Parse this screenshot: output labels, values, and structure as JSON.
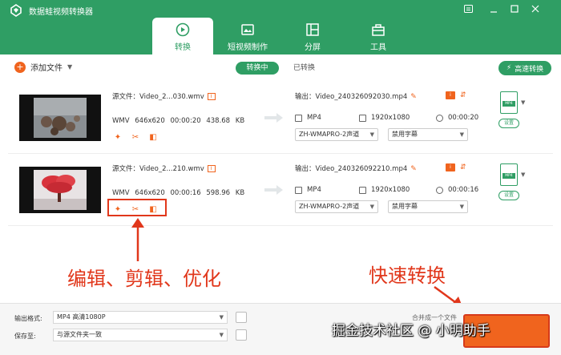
{
  "app": {
    "title": "数据蛙视频转换器",
    "brand_color": "#2f9e64",
    "accent_color": "#f0641e",
    "annotation_color": "#e1371b"
  },
  "window_controls": [
    "menu-icon",
    "minimize-icon",
    "restore-icon",
    "close-icon"
  ],
  "nav": {
    "tabs": [
      {
        "label": "转换",
        "icon": "convert-icon",
        "active": true
      },
      {
        "label": "短视频制作",
        "icon": "clip-icon",
        "active": false
      },
      {
        "label": "分屏",
        "icon": "split-screen-icon",
        "active": false
      },
      {
        "label": "工具",
        "icon": "toolbox-icon",
        "active": false
      }
    ]
  },
  "toolbar": {
    "add_file": "添加文件",
    "tab_converting": "转换中",
    "tab_converted": "已转换",
    "fast_convert": "高速转换"
  },
  "files": [
    {
      "source": "源文件：Video_2...030.wmv",
      "format": "WMV",
      "resolution": "646x620",
      "duration": "00:00:20",
      "size": "438.68 KB",
      "output": "输出：Video_240326092030.mp4",
      "out_format": "MP4",
      "out_resolution": "1920x1080",
      "out_duration": "00:00:20",
      "audio": "ZH-WMAPRO-2声道",
      "subtitle": "禁用字幕",
      "settings": "设置",
      "format_icon_label": "MP4"
    },
    {
      "source": "源文件：Video_2...210.wmv",
      "format": "WMV",
      "resolution": "646x620",
      "duration": "00:00:16",
      "size": "598.96 KB",
      "output": "输出：Video_240326092210.mp4",
      "out_format": "MP4",
      "out_resolution": "1920x1080",
      "out_duration": "00:00:16",
      "audio": "ZH-WMAPRO-2声道",
      "subtitle": "禁用字幕",
      "settings": "设置",
      "format_icon_label": "MP4"
    }
  ],
  "annotations": {
    "edit_tools": "编辑、剪辑、优化",
    "fast_convert": "快速转换"
  },
  "bottom": {
    "output_format_label": "输出格式:",
    "output_format_value": "MP4 高清1080P",
    "save_to_label": "保存至:",
    "save_to_value": "与源文件夹一致",
    "merge_label": "合并成一个文件"
  },
  "watermark": "掘金技术社区 @ 小明助手"
}
